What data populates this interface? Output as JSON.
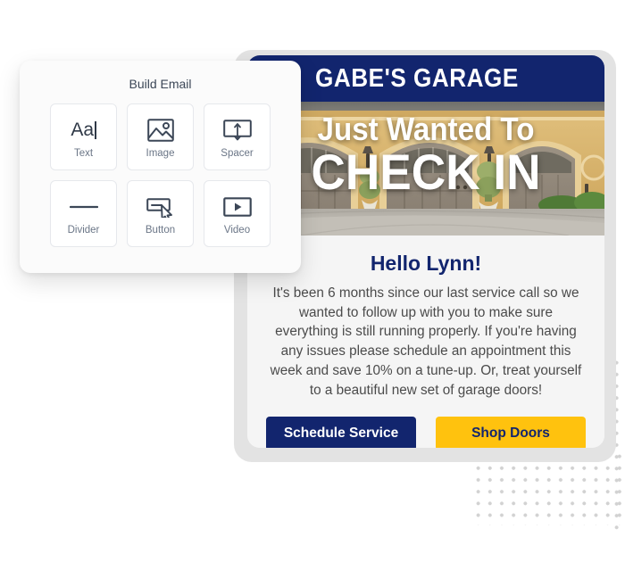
{
  "builder": {
    "title": "Build Email",
    "tiles": [
      {
        "label": "Text",
        "icon": "text-aa-icon"
      },
      {
        "label": "Image",
        "icon": "image-picture-icon"
      },
      {
        "label": "Spacer",
        "icon": "spacer-arrow-icon"
      },
      {
        "label": "Divider",
        "icon": "divider-line-icon"
      },
      {
        "label": "Button",
        "icon": "button-cursor-icon"
      },
      {
        "label": "Video",
        "icon": "video-play-icon"
      }
    ]
  },
  "email": {
    "brand_name": "GABE'S GARAGE",
    "logo_icon": "wrench-screwdriver-icon",
    "hero": {
      "line1": "Just Wanted To",
      "line2": "CHECK IN",
      "photo_alt": "garage-doors-photo"
    },
    "greeting": "Hello Lynn!",
    "body": "It's been 6 months since our last service call so we wanted to follow up with you to make sure everything is still running properly. If you're having any issues please schedule an appointment this week and save 10% on a tune-up. Or, treat yourself to a beautiful new set of garage doors!",
    "cta_primary": "Schedule Service",
    "cta_secondary": "Shop Doors"
  },
  "colors": {
    "navy": "#12256e",
    "gold": "#ffc20e",
    "panel_bg": "#fbfbfb",
    "frame_gray": "#e3e3e3",
    "dot_gray": "#d2d2d2"
  }
}
